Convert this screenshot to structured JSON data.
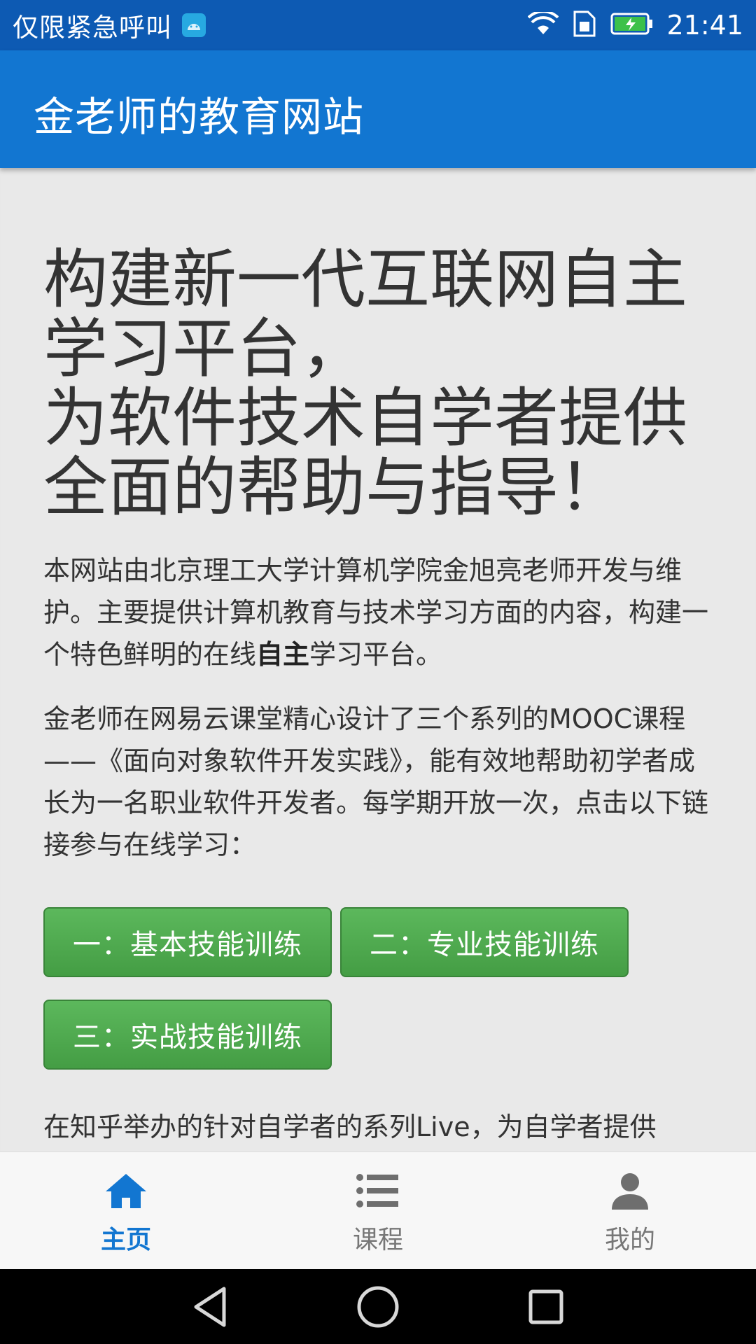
{
  "status_bar": {
    "carrier": "仅限紧急呼叫",
    "time": "21:41",
    "icons": [
      "android-debug-icon",
      "wifi-icon",
      "sim-icon",
      "battery-charging-icon"
    ]
  },
  "app_bar": {
    "title": "金老师的教育网站"
  },
  "content": {
    "hero_lines": [
      "构建新一代互联网自主",
      "学习平台，",
      "为软件技术自学者提供",
      "全面的帮助与指导！"
    ],
    "para1_before": "本网站由北京理工大学计算机学院金旭亮老师开发与维护。主要提供计算机教育与技术学习方面的内容，构建一个特色鲜明的在线",
    "para1_bold": "自主",
    "para1_after": "学习平台。",
    "para2": "金老师在网易云课堂精心设计了三个系列的MOOC课程——《面向对象软件开发实践》，能有效地帮助初学者成长为一名职业软件开发者。每学期开放一次，点击以下链接参与在线学习：",
    "buttons": [
      {
        "label": "一：基本技能训练"
      },
      {
        "label": "二：专业技能训练"
      },
      {
        "label": "三：实战技能训练"
      }
    ],
    "para3": "在知乎举办的针对自学者的系列Live，为自学者提供"
  },
  "tabs": [
    {
      "label": "主页",
      "icon": "home-icon",
      "active": true
    },
    {
      "label": "课程",
      "icon": "list-icon",
      "active": false
    },
    {
      "label": "我的",
      "icon": "person-icon",
      "active": false
    }
  ],
  "colors": {
    "status_bar": "#0d5ab3",
    "app_bar": "#1276d1",
    "button_green": "#5cb85c",
    "active_tab": "#1276d1"
  }
}
